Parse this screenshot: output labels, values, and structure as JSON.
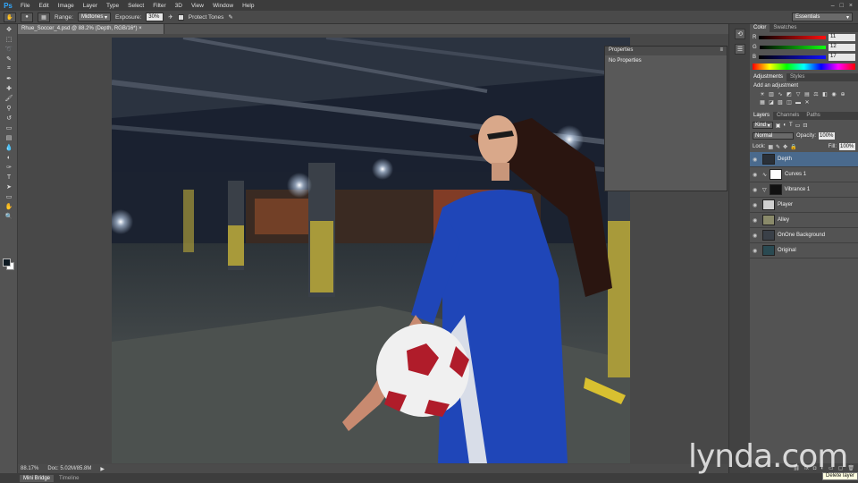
{
  "app": {
    "logo": "Ps"
  },
  "menu": [
    "File",
    "Edit",
    "Image",
    "Layer",
    "Type",
    "Select",
    "Filter",
    "3D",
    "View",
    "Window",
    "Help"
  ],
  "window_controls": [
    "–",
    "□",
    "×"
  ],
  "options_bar": {
    "range_label": "Range:",
    "range_value": "Midtones",
    "exposure_label": "Exposure:",
    "exposure_value": "30%",
    "protect_tones_label": "Protect Tones",
    "workspace": "Essentials"
  },
  "document": {
    "tab_title": "Rhue_Soccer_4.psd @ 88.2% (Depth, RGB/16*)",
    "zoom": "88.17%",
    "doc_size": "Doc: 5.02M/85.8M"
  },
  "properties_panel": {
    "title": "Properties",
    "body": "No Properties"
  },
  "color_panel": {
    "tabs": [
      "Color",
      "Swatches"
    ],
    "channels": [
      {
        "label": "R",
        "value": "11",
        "from": "#000000",
        "to": "#ff1010"
      },
      {
        "label": "G",
        "value": "12",
        "from": "#000000",
        "to": "#10ff10"
      },
      {
        "label": "B",
        "value": "17",
        "from": "#000000",
        "to": "#1010ff"
      }
    ]
  },
  "adjustments_panel": {
    "tabs": [
      "Adjustments",
      "Styles"
    ],
    "title": "Add an adjustment"
  },
  "layers_panel": {
    "tabs": [
      "Layers",
      "Channels",
      "Paths"
    ],
    "filter": "Kind",
    "blend_mode": "Normal",
    "opacity_label": "Opacity:",
    "opacity_value": "100%",
    "lock_label": "Lock:",
    "fill_label": "Fill:",
    "fill_value": "100%",
    "layers": [
      {
        "name": "Depth",
        "selected": true,
        "type": "pixel"
      },
      {
        "name": "Curves 1",
        "selected": false,
        "type": "adjustment"
      },
      {
        "name": "Vibrance 1",
        "selected": false,
        "type": "adjustment"
      },
      {
        "name": "Player",
        "selected": false,
        "type": "pixel"
      },
      {
        "name": "Alley",
        "selected": false,
        "type": "pixel"
      },
      {
        "name": "OnOne Background",
        "selected": false,
        "type": "pixel"
      },
      {
        "name": "Original",
        "selected": false,
        "type": "pixel"
      }
    ]
  },
  "tooltip": "Delete layer",
  "bottom_tabs": [
    "Mini Bridge",
    "Timeline"
  ],
  "watermark": "lynda.com"
}
